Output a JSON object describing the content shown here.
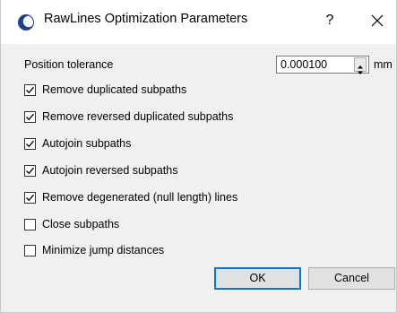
{
  "window": {
    "title": "RawLines Optimization Parameters",
    "help_label": "?",
    "app_icon": "half-moon-blue-icon",
    "accent_color": "#0078d7"
  },
  "tolerance": {
    "label": "Position tolerance",
    "value": "0.000100",
    "unit": "mm"
  },
  "options": [
    {
      "label": "Remove duplicated subpaths",
      "checked": true
    },
    {
      "label": "Remove reversed duplicated subpaths",
      "checked": true
    },
    {
      "label": "Autojoin subpaths",
      "checked": true
    },
    {
      "label": "Autojoin reversed subpaths",
      "checked": true
    },
    {
      "label": "Remove degenerated (null length) lines",
      "checked": true
    },
    {
      "label": "Close subpaths",
      "checked": false
    },
    {
      "label": "Minimize jump distances",
      "checked": false
    }
  ],
  "buttons": {
    "ok": "OK",
    "cancel": "Cancel"
  }
}
